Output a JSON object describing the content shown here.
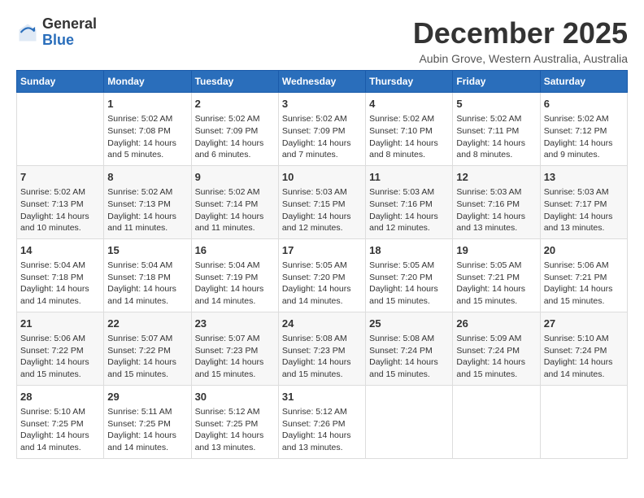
{
  "logo": {
    "general": "General",
    "blue": "Blue"
  },
  "title": "December 2025",
  "location": "Aubin Grove, Western Australia, Australia",
  "headers": [
    "Sunday",
    "Monday",
    "Tuesday",
    "Wednesday",
    "Thursday",
    "Friday",
    "Saturday"
  ],
  "weeks": [
    [
      {
        "day": "",
        "info": ""
      },
      {
        "day": "1",
        "info": "Sunrise: 5:02 AM\nSunset: 7:08 PM\nDaylight: 14 hours\nand 5 minutes."
      },
      {
        "day": "2",
        "info": "Sunrise: 5:02 AM\nSunset: 7:09 PM\nDaylight: 14 hours\nand 6 minutes."
      },
      {
        "day": "3",
        "info": "Sunrise: 5:02 AM\nSunset: 7:09 PM\nDaylight: 14 hours\nand 7 minutes."
      },
      {
        "day": "4",
        "info": "Sunrise: 5:02 AM\nSunset: 7:10 PM\nDaylight: 14 hours\nand 8 minutes."
      },
      {
        "day": "5",
        "info": "Sunrise: 5:02 AM\nSunset: 7:11 PM\nDaylight: 14 hours\nand 8 minutes."
      },
      {
        "day": "6",
        "info": "Sunrise: 5:02 AM\nSunset: 7:12 PM\nDaylight: 14 hours\nand 9 minutes."
      }
    ],
    [
      {
        "day": "7",
        "info": "Sunrise: 5:02 AM\nSunset: 7:13 PM\nDaylight: 14 hours\nand 10 minutes."
      },
      {
        "day": "8",
        "info": "Sunrise: 5:02 AM\nSunset: 7:13 PM\nDaylight: 14 hours\nand 11 minutes."
      },
      {
        "day": "9",
        "info": "Sunrise: 5:02 AM\nSunset: 7:14 PM\nDaylight: 14 hours\nand 11 minutes."
      },
      {
        "day": "10",
        "info": "Sunrise: 5:03 AM\nSunset: 7:15 PM\nDaylight: 14 hours\nand 12 minutes."
      },
      {
        "day": "11",
        "info": "Sunrise: 5:03 AM\nSunset: 7:16 PM\nDaylight: 14 hours\nand 12 minutes."
      },
      {
        "day": "12",
        "info": "Sunrise: 5:03 AM\nSunset: 7:16 PM\nDaylight: 14 hours\nand 13 minutes."
      },
      {
        "day": "13",
        "info": "Sunrise: 5:03 AM\nSunset: 7:17 PM\nDaylight: 14 hours\nand 13 minutes."
      }
    ],
    [
      {
        "day": "14",
        "info": "Sunrise: 5:04 AM\nSunset: 7:18 PM\nDaylight: 14 hours\nand 14 minutes."
      },
      {
        "day": "15",
        "info": "Sunrise: 5:04 AM\nSunset: 7:18 PM\nDaylight: 14 hours\nand 14 minutes."
      },
      {
        "day": "16",
        "info": "Sunrise: 5:04 AM\nSunset: 7:19 PM\nDaylight: 14 hours\nand 14 minutes."
      },
      {
        "day": "17",
        "info": "Sunrise: 5:05 AM\nSunset: 7:20 PM\nDaylight: 14 hours\nand 14 minutes."
      },
      {
        "day": "18",
        "info": "Sunrise: 5:05 AM\nSunset: 7:20 PM\nDaylight: 14 hours\nand 15 minutes."
      },
      {
        "day": "19",
        "info": "Sunrise: 5:05 AM\nSunset: 7:21 PM\nDaylight: 14 hours\nand 15 minutes."
      },
      {
        "day": "20",
        "info": "Sunrise: 5:06 AM\nSunset: 7:21 PM\nDaylight: 14 hours\nand 15 minutes."
      }
    ],
    [
      {
        "day": "21",
        "info": "Sunrise: 5:06 AM\nSunset: 7:22 PM\nDaylight: 14 hours\nand 15 minutes."
      },
      {
        "day": "22",
        "info": "Sunrise: 5:07 AM\nSunset: 7:22 PM\nDaylight: 14 hours\nand 15 minutes."
      },
      {
        "day": "23",
        "info": "Sunrise: 5:07 AM\nSunset: 7:23 PM\nDaylight: 14 hours\nand 15 minutes."
      },
      {
        "day": "24",
        "info": "Sunrise: 5:08 AM\nSunset: 7:23 PM\nDaylight: 14 hours\nand 15 minutes."
      },
      {
        "day": "25",
        "info": "Sunrise: 5:08 AM\nSunset: 7:24 PM\nDaylight: 14 hours\nand 15 minutes."
      },
      {
        "day": "26",
        "info": "Sunrise: 5:09 AM\nSunset: 7:24 PM\nDaylight: 14 hours\nand 15 minutes."
      },
      {
        "day": "27",
        "info": "Sunrise: 5:10 AM\nSunset: 7:24 PM\nDaylight: 14 hours\nand 14 minutes."
      }
    ],
    [
      {
        "day": "28",
        "info": "Sunrise: 5:10 AM\nSunset: 7:25 PM\nDaylight: 14 hours\nand 14 minutes."
      },
      {
        "day": "29",
        "info": "Sunrise: 5:11 AM\nSunset: 7:25 PM\nDaylight: 14 hours\nand 14 minutes."
      },
      {
        "day": "30",
        "info": "Sunrise: 5:12 AM\nSunset: 7:25 PM\nDaylight: 14 hours\nand 13 minutes."
      },
      {
        "day": "31",
        "info": "Sunrise: 5:12 AM\nSunset: 7:26 PM\nDaylight: 14 hours\nand 13 minutes."
      },
      {
        "day": "",
        "info": ""
      },
      {
        "day": "",
        "info": ""
      },
      {
        "day": "",
        "info": ""
      }
    ]
  ]
}
